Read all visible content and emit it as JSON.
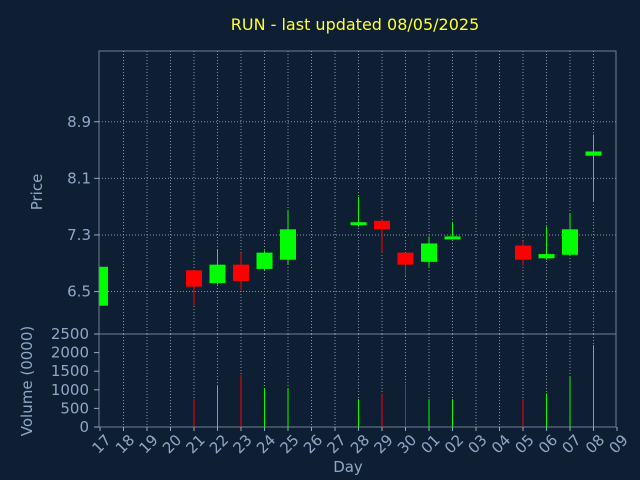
{
  "chart_data": {
    "type": "candlestick",
    "title": "RUN - last updated 08/05/2025",
    "price_panel": {
      "ylabel": "Price",
      "ylim": [
        5.9,
        9.9
      ],
      "yticks": [
        6.5,
        7.3,
        8.1,
        8.9
      ],
      "ytick_labels": [
        "6.5",
        "7.3",
        "8.1",
        "8.9"
      ]
    },
    "volume_panel": {
      "ylabel": "Volume (0000)",
      "ylim": [
        0,
        2500
      ],
      "yticks": [
        0,
        500,
        1000,
        1500,
        2000,
        2500
      ],
      "ytick_labels": [
        "0",
        "500",
        "1000",
        "1500",
        "2000",
        "2500"
      ]
    },
    "xlabel": "Day",
    "x_tick_labels": [
      "17",
      "18",
      "19",
      "20",
      "21",
      "22",
      "23",
      "24",
      "25",
      "26",
      "27",
      "28",
      "29",
      "30",
      "01",
      "02",
      "03",
      "04",
      "05",
      "06",
      "07",
      "08",
      "09"
    ],
    "grid": true,
    "colors": {
      "up": "#00ff00",
      "down": "#ff0000",
      "background": "#0f1f33",
      "title": "#ffff33",
      "text": "#8fa8c8"
    },
    "candles": [
      {
        "day": "17",
        "open": 6.3,
        "high": 6.85,
        "low": 6.3,
        "close": 6.85,
        "volume": 0
      },
      {
        "day": "21",
        "open": 6.8,
        "high": 6.8,
        "low": 6.3,
        "close": 6.57,
        "volume": 750
      },
      {
        "day": "22",
        "open": 6.62,
        "high": 7.1,
        "low": 6.6,
        "close": 6.88,
        "volume": 1100
      },
      {
        "day": "23",
        "open": 6.88,
        "high": 7.05,
        "low": 6.52,
        "close": 6.65,
        "volume": 1400
      },
      {
        "day": "24",
        "open": 6.82,
        "high": 7.08,
        "low": 6.8,
        "close": 7.05,
        "volume": 1050
      },
      {
        "day": "25",
        "open": 6.95,
        "high": 7.65,
        "low": 6.88,
        "close": 7.38,
        "volume": 1050
      },
      {
        "day": "28",
        "open": 7.44,
        "high": 7.84,
        "low": 7.42,
        "close": 7.48,
        "volume": 750
      },
      {
        "day": "29",
        "open": 7.5,
        "high": 7.52,
        "low": 7.05,
        "close": 7.38,
        "volume": 900
      },
      {
        "day": "30",
        "open": 7.05,
        "high": 7.05,
        "low": 6.72,
        "close": 6.88,
        "volume": 1150
      },
      {
        "day": "01",
        "open": 6.92,
        "high": 7.28,
        "low": 6.85,
        "close": 7.18,
        "volume": 750
      },
      {
        "day": "02",
        "open": 7.25,
        "high": 7.48,
        "low": 7.24,
        "close": 7.28,
        "volume": 750
      },
      {
        "day": "05",
        "open": 7.15,
        "high": 7.22,
        "low": 6.87,
        "close": 6.95,
        "volume": 750
      },
      {
        "day": "06",
        "open": 6.97,
        "high": 7.42,
        "low": 6.95,
        "close": 7.03,
        "volume": 900
      },
      {
        "day": "07",
        "open": 7.02,
        "high": 7.6,
        "low": 7.0,
        "close": 7.38,
        "volume": 1350
      },
      {
        "day": "08",
        "open": 8.42,
        "high": 8.72,
        "low": 7.78,
        "close": 8.48,
        "volume": 2200
      }
    ]
  }
}
